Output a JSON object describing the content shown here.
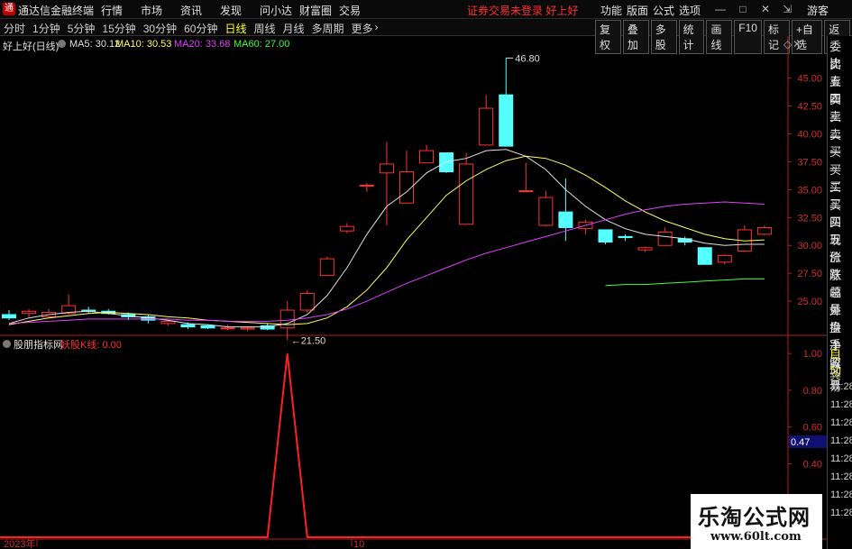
{
  "titlebar": {
    "logo": "通",
    "app_title": "通达信金融终端",
    "menu": [
      "行情",
      "市场",
      "资讯",
      "发现",
      "问小达",
      "财富圈",
      "交易"
    ],
    "status_message": "证券交易未登录  好上好",
    "right_menu": [
      "功能",
      "版面",
      "公式",
      "选项"
    ],
    "guest": "游客"
  },
  "toolbar": {
    "periods": [
      "分时",
      "1分钟",
      "5分钟",
      "15分钟",
      "30分钟",
      "60分钟",
      "日线",
      "周线",
      "月线",
      "多周期",
      "更多"
    ],
    "active_period": "日线",
    "right_tools": [
      "复权",
      "叠加",
      "多股",
      "统计",
      "画线",
      "F10",
      "标记",
      "+自选",
      "返回"
    ]
  },
  "main_chart": {
    "stock_title": "好上好(日线)",
    "ma_legend": [
      {
        "label": "MA5: 30.12",
        "color": "#e0e0e0"
      },
      {
        "label": "MA10: 30.53",
        "color": "#ffff60"
      },
      {
        "label": "MA20: 33.68",
        "color": "#e040ff"
      },
      {
        "label": "MA60: 27.00",
        "color": "#40ff40"
      }
    ],
    "high_marker": "46.80",
    "low_marker": "21.50"
  },
  "indicator": {
    "title": "股朋指标网",
    "line_label": "妖股K线: 0.00"
  },
  "x_axis": {
    "labels": [
      "2023年",
      "10"
    ]
  },
  "side_panel": {
    "items": [
      "委比",
      "卖五",
      "卖四",
      "卖三",
      "卖二",
      "卖一",
      "买一",
      "买二",
      "买三",
      "买四",
      "买五",
      "现价",
      "涨跌",
      "涨幅",
      "总量",
      "外盘",
      "换手",
      "净资",
      "收益"
    ],
    "auto_trade": [
      "自动",
      "交易"
    ],
    "times": [
      "11:28",
      "11:28",
      "11:28",
      "11:28",
      "11:28",
      "11:28",
      "11:28",
      "11:28"
    ]
  },
  "watermark": {
    "main": "乐淘公式网",
    "url": "www.60lt.com"
  },
  "chart_data": [
    {
      "type": "candlestick",
      "title": "好上好(日线)",
      "y_ticks": [
        25.0,
        27.5,
        30.0,
        32.5,
        35.0,
        37.5,
        40.0,
        42.5,
        45.0
      ],
      "ylim": [
        22.1,
        47.8
      ],
      "grid": false,
      "candles": [
        {
          "o": 23.8,
          "h": 24.2,
          "l": 23.3,
          "c": 23.5
        },
        {
          "o": 23.9,
          "h": 24.3,
          "l": 23.5,
          "c": 24.1
        },
        {
          "o": 23.6,
          "h": 24.3,
          "l": 23.5,
          "c": 24.0
        },
        {
          "o": 23.9,
          "h": 25.6,
          "l": 23.8,
          "c": 24.6
        },
        {
          "o": 24.2,
          "h": 24.5,
          "l": 23.9,
          "c": 24.1
        },
        {
          "o": 24.1,
          "h": 24.3,
          "l": 23.8,
          "c": 23.9
        },
        {
          "o": 23.8,
          "h": 24.0,
          "l": 23.3,
          "c": 23.6
        },
        {
          "o": 23.6,
          "h": 23.8,
          "l": 23.0,
          "c": 23.3
        },
        {
          "o": 23.0,
          "h": 23.3,
          "l": 22.8,
          "c": 23.2
        },
        {
          "o": 22.9,
          "h": 23.1,
          "l": 22.5,
          "c": 22.7
        },
        {
          "o": 22.8,
          "h": 22.9,
          "l": 22.5,
          "c": 22.6
        },
        {
          "o": 22.6,
          "h": 22.9,
          "l": 22.4,
          "c": 22.6
        },
        {
          "o": 22.5,
          "h": 22.7,
          "l": 22.3,
          "c": 22.6
        },
        {
          "o": 22.8,
          "h": 23.0,
          "l": 22.4,
          "c": 22.5
        },
        {
          "o": 22.6,
          "h": 25.0,
          "l": 21.5,
          "c": 24.2
        },
        {
          "o": 24.2,
          "h": 26.0,
          "l": 24.0,
          "c": 25.7
        },
        {
          "o": 27.3,
          "h": 29.0,
          "l": 27.3,
          "c": 28.8
        },
        {
          "o": 31.3,
          "h": 32.0,
          "l": 31.1,
          "c": 31.7
        },
        {
          "o": 35.4,
          "h": 35.6,
          "l": 34.8,
          "c": 35.4
        },
        {
          "o": 36.5,
          "h": 39.3,
          "l": 31.8,
          "c": 37.3
        },
        {
          "o": 33.8,
          "h": 38.5,
          "l": 33.8,
          "c": 36.6
        },
        {
          "o": 37.4,
          "h": 39.0,
          "l": 37.4,
          "c": 38.5
        },
        {
          "o": 38.3,
          "h": 38.3,
          "l": 36.5,
          "c": 36.6
        },
        {
          "o": 31.9,
          "h": 38.3,
          "l": 31.9,
          "c": 37.3
        },
        {
          "o": 39.0,
          "h": 43.5,
          "l": 39.0,
          "c": 42.3
        },
        {
          "o": 43.5,
          "h": 46.8,
          "l": 38.9,
          "c": 38.9
        },
        {
          "o": 34.9,
          "h": 37.4,
          "l": 34.8,
          "c": 34.9
        },
        {
          "o": 31.8,
          "h": 34.9,
          "l": 31.7,
          "c": 34.3
        },
        {
          "o": 33.0,
          "h": 36.0,
          "l": 30.4,
          "c": 31.6
        },
        {
          "o": 31.5,
          "h": 32.3,
          "l": 31.0,
          "c": 32.1
        },
        {
          "o": 31.4,
          "h": 31.4,
          "l": 30.1,
          "c": 30.3
        },
        {
          "o": 30.8,
          "h": 31.0,
          "l": 30.4,
          "c": 30.7
        },
        {
          "o": 29.6,
          "h": 29.9,
          "l": 29.4,
          "c": 29.8
        },
        {
          "o": 30.0,
          "h": 31.6,
          "l": 30.0,
          "c": 31.2
        },
        {
          "o": 30.6,
          "h": 30.8,
          "l": 30.0,
          "c": 30.3
        },
        {
          "o": 29.8,
          "h": 29.8,
          "l": 28.3,
          "c": 28.3
        },
        {
          "o": 28.5,
          "h": 29.2,
          "l": 28.3,
          "c": 29.1
        },
        {
          "o": 29.5,
          "h": 31.8,
          "l": 29.4,
          "c": 31.4
        },
        {
          "o": 31.0,
          "h": 31.8,
          "l": 30.9,
          "c": 31.6
        }
      ],
      "series": [
        {
          "name": "MA5",
          "color": "#e0e0e0",
          "values": [
            23.0,
            23.5,
            23.8,
            24.0,
            24.1,
            23.9,
            23.7,
            23.5,
            23.3,
            23.0,
            22.9,
            22.7,
            22.7,
            22.7,
            23.0,
            23.8,
            25.5,
            28.0,
            31.0,
            33.5,
            34.8,
            36.5,
            37.5,
            37.8,
            38.5,
            38.6,
            38.0,
            36.8,
            35.0,
            33.5,
            32.3,
            31.5,
            31.0,
            30.8,
            30.6,
            30.2,
            30.0,
            30.1,
            30.1
          ]
        },
        {
          "name": "MA10",
          "color": "#ffff60",
          "values": [
            22.9,
            23.2,
            23.5,
            23.7,
            23.9,
            24.0,
            23.9,
            23.8,
            23.6,
            23.5,
            23.3,
            23.2,
            23.1,
            23.0,
            22.9,
            23.0,
            23.5,
            24.5,
            26.0,
            28.0,
            30.5,
            32.5,
            34.5,
            35.8,
            36.8,
            37.6,
            38.0,
            37.8,
            37.2,
            36.3,
            35.2,
            34.0,
            33.0,
            32.2,
            31.6,
            31.0,
            30.6,
            30.4,
            30.5
          ]
        },
        {
          "name": "MA20",
          "color": "#e040ff",
          "values": [
            23.0,
            23.1,
            23.2,
            23.3,
            23.4,
            23.4,
            23.4,
            23.4,
            23.4,
            23.3,
            23.3,
            23.2,
            23.2,
            23.2,
            23.3,
            23.5,
            23.8,
            24.3,
            25.0,
            25.8,
            26.6,
            27.3,
            28.0,
            28.7,
            29.3,
            29.8,
            30.3,
            30.8,
            31.3,
            31.8,
            32.3,
            32.8,
            33.2,
            33.5,
            33.7,
            33.8,
            33.9,
            33.8,
            33.7
          ]
        },
        {
          "name": "MA60",
          "color": "#40ff40",
          "values": [
            null,
            null,
            null,
            null,
            null,
            null,
            null,
            null,
            null,
            null,
            null,
            null,
            null,
            null,
            null,
            null,
            null,
            null,
            null,
            null,
            null,
            null,
            null,
            null,
            null,
            null,
            null,
            null,
            null,
            null,
            26.4,
            26.5,
            26.5,
            26.6,
            26.7,
            26.8,
            26.9,
            27.0,
            27.0
          ]
        }
      ]
    },
    {
      "type": "line",
      "title": "股朋指标网",
      "y_ticks": [
        0.0,
        0.2,
        0.4,
        0.6,
        0.8,
        1.0
      ],
      "ylim": [
        0,
        1.05
      ],
      "current_value_label": "0.47",
      "series": [
        {
          "name": "妖股K线",
          "color": "#ff2020",
          "values": [
            0,
            0,
            0,
            0,
            0,
            0,
            0,
            0,
            0,
            0,
            0,
            0,
            0,
            0,
            1,
            0,
            0,
            0,
            0,
            0,
            0,
            0,
            0,
            0,
            0,
            0,
            0,
            0,
            0,
            0,
            0,
            0,
            0,
            0,
            0,
            0,
            0,
            0,
            0
          ]
        }
      ]
    }
  ]
}
